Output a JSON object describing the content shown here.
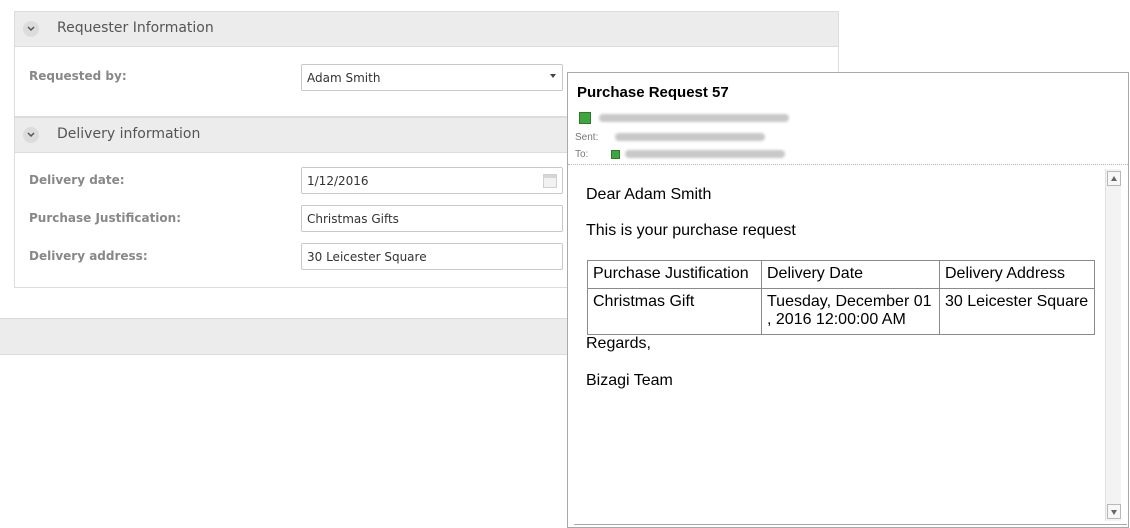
{
  "requester_panel": {
    "title": "Requester Information",
    "requested_by_label": "Requested by:",
    "requested_by_value": "Adam Smith"
  },
  "delivery_panel": {
    "title": "Delivery information",
    "date_label": "Delivery date:",
    "date_value": "1/12/2016",
    "justification_label": "Purchase Justification:",
    "justification_value": "Christmas Gifts",
    "address_label": "Delivery address:",
    "address_value": "30 Leicester Square"
  },
  "email": {
    "subject": "Purchase Request 57",
    "sent_label": "Sent:",
    "to_label": "To:",
    "greeting": "Dear Adam Smith",
    "intro": "This is your purchase request",
    "table": {
      "headers": [
        "Purchase Justification",
        "Delivery Date",
        "Delivery Address"
      ],
      "row": [
        "Christmas Gift",
        "Tuesday, December 01 , 2016 12:00:00 AM",
        "30 Leicester Square"
      ]
    },
    "regards": "Regards,",
    "signature": "Bizagi Team"
  },
  "icons": {
    "collapse": "chevron-down-icon",
    "dropdown": "dropdown-arrow-icon",
    "calendar": "calendar-icon",
    "contact": "contact-card-icon",
    "scroll_up": "scroll-up-icon",
    "scroll_down": "scroll-down-icon"
  },
  "colors": {
    "panel_header_bg": "#ececec",
    "contact_icon": "#3fa63f",
    "label_text": "#888888"
  }
}
